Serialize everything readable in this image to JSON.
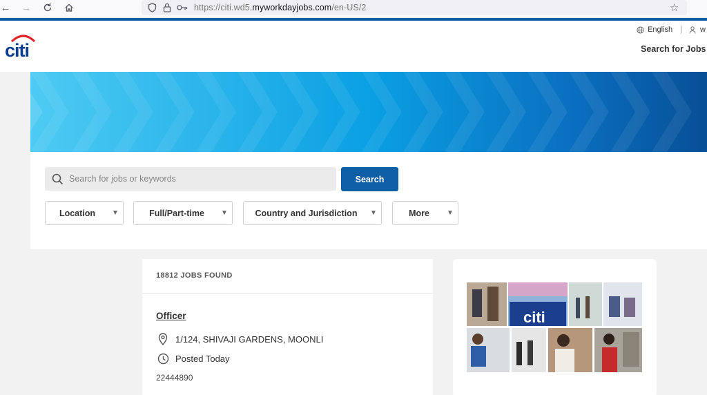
{
  "browser": {
    "url_prefix": "https://citi.wd5.",
    "url_domain": "myworkdayjobs.com",
    "url_path": "/en-US/2"
  },
  "header": {
    "language": "English",
    "user_initial": "w",
    "search_for_jobs": "Search for Jobs"
  },
  "search": {
    "placeholder": "Search for jobs or keywords",
    "button_label": "Search"
  },
  "filters": [
    {
      "label": "Location"
    },
    {
      "label": "Full/Part-time"
    },
    {
      "label": "Country and Jurisdiction"
    },
    {
      "label": "More"
    }
  ],
  "results": {
    "count_label": "18812 JOBS FOUND",
    "jobs": [
      {
        "title": "Officer",
        "location": "1/124, SHIVAJI GARDENS, MOONLI",
        "posted": "Posted Today",
        "id": "22444890"
      }
    ]
  },
  "colors": {
    "brand_blue": "#0f5fa6",
    "logo_red": "#e3232a",
    "logo_blue": "#0b3d91"
  },
  "icons": [
    "back-arrow-icon",
    "forward-arrow-icon",
    "reload-icon",
    "home-icon",
    "shield-icon",
    "lock-icon",
    "key-icon",
    "star-icon",
    "globe-icon",
    "user-icon",
    "search-icon",
    "caret-down-icon",
    "location-pin-icon",
    "clock-icon"
  ]
}
